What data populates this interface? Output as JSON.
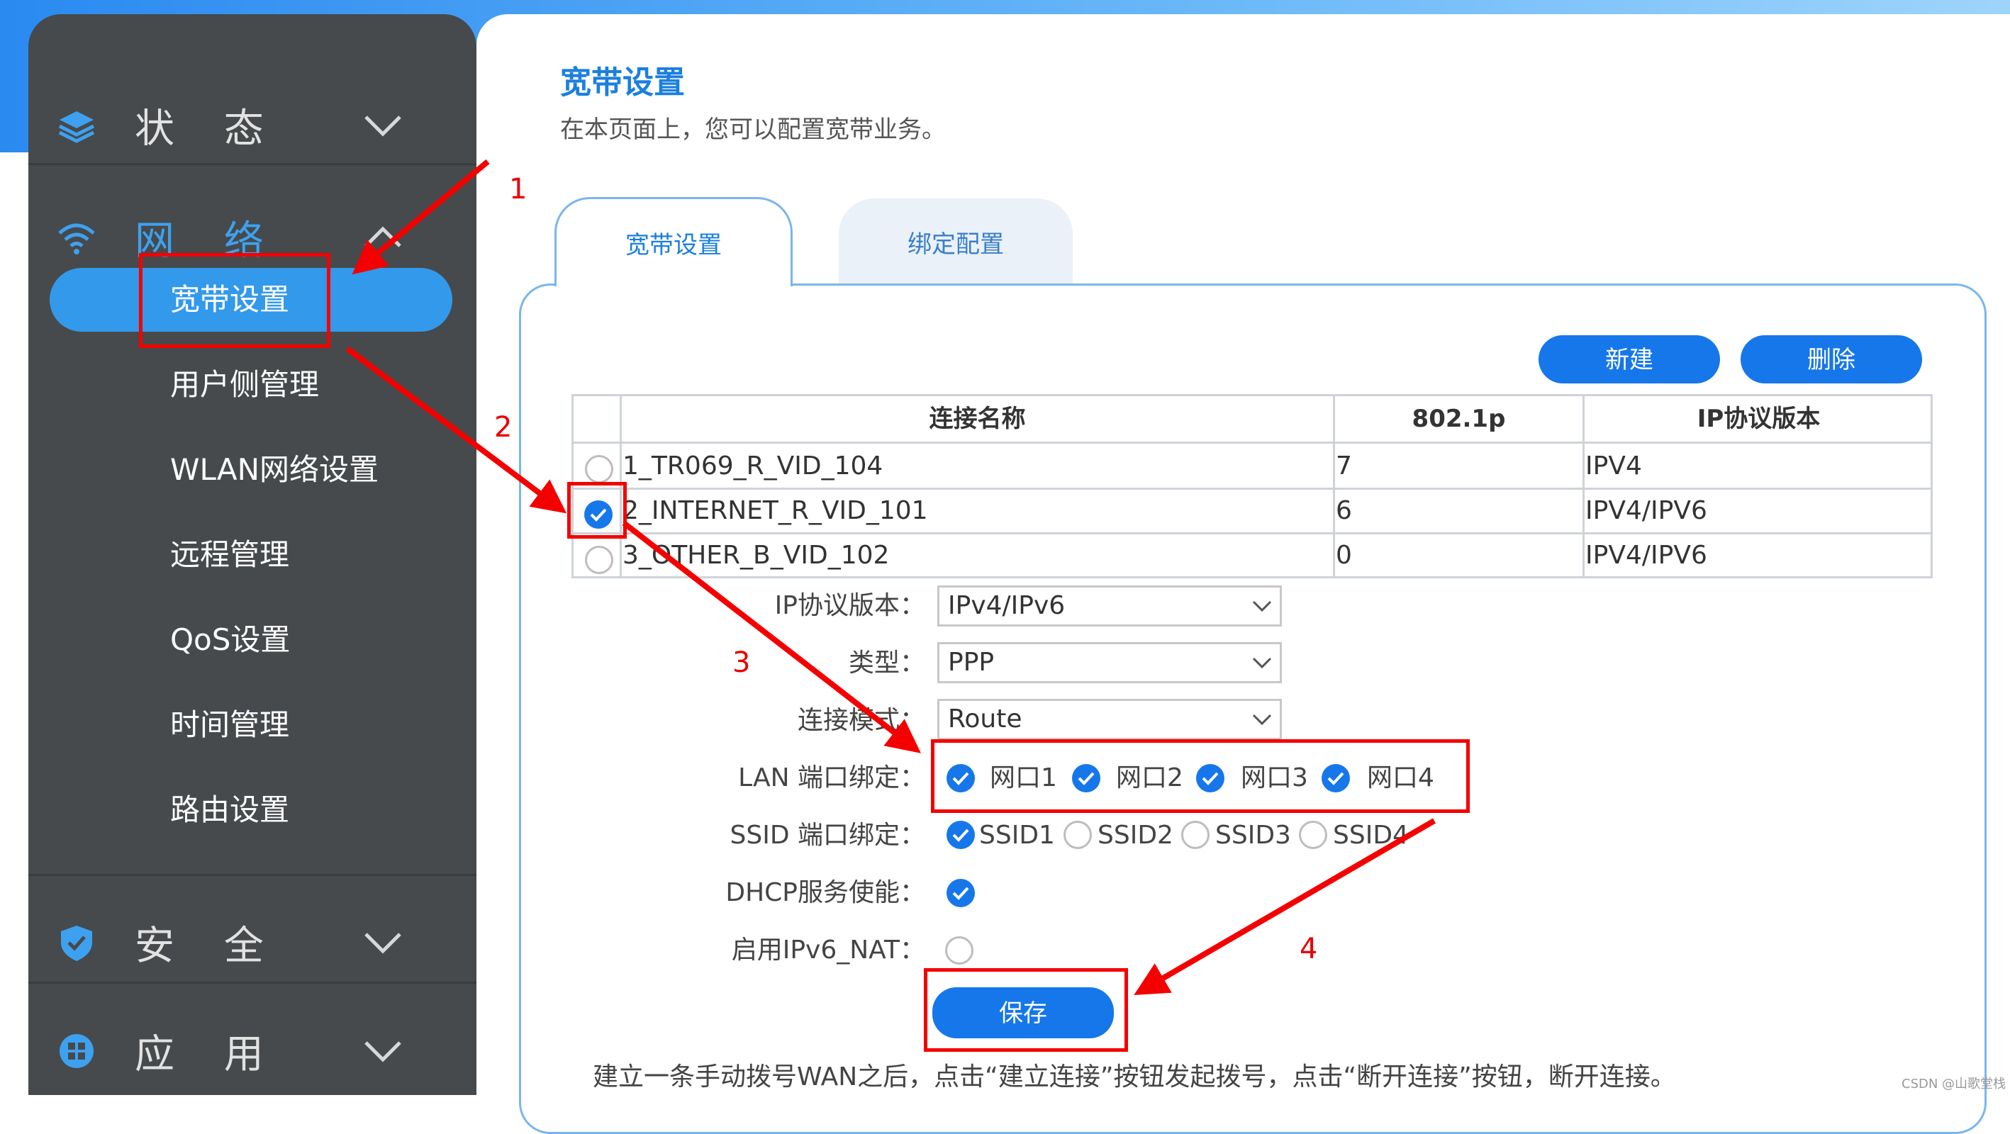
{
  "sidebar": {
    "sections": [
      {
        "label": "状 态",
        "icon": "layers-icon",
        "expanded": false
      },
      {
        "label": "网 络",
        "icon": "wifi-icon",
        "expanded": true
      },
      {
        "label": "安 全",
        "icon": "shield-icon",
        "expanded": false
      },
      {
        "label": "应 用",
        "icon": "apps-icon",
        "expanded": false
      }
    ],
    "network_items": [
      "宽带设置",
      "用户侧管理",
      "WLAN网络设置",
      "远程管理",
      "QoS设置",
      "时间管理",
      "路由设置"
    ],
    "active_item": "宽带设置"
  },
  "header": {
    "title": "宽带设置",
    "description": "在本页面上，您可以配置宽带业务。"
  },
  "tabs": [
    {
      "label": "宽带设置",
      "active": true
    },
    {
      "label": "绑定配置",
      "active": false
    }
  ],
  "toolbar": {
    "new_label": "新建",
    "delete_label": "删除"
  },
  "table": {
    "headers": [
      "连接名称",
      "802.1p",
      "IP协议版本"
    ],
    "rows": [
      {
        "name": "1_TR069_R_VID_104",
        "priority": "7",
        "ip_version": "IPV4",
        "selected": false
      },
      {
        "name": "2_INTERNET_R_VID_101",
        "priority": "6",
        "ip_version": "IPV4/IPV6",
        "selected": true
      },
      {
        "name": "3_OTHER_B_VID_102",
        "priority": "0",
        "ip_version": "IPV4/IPV6",
        "selected": false
      }
    ]
  },
  "form": {
    "ip_version": {
      "label": "IP协议版本：",
      "value": "IPv4/IPv6"
    },
    "type": {
      "label": "类型：",
      "value": "PPP"
    },
    "conn_mode": {
      "label": "连接模式：",
      "value": "Route"
    },
    "lan_binding": {
      "label": "LAN 端口绑定：",
      "options": [
        {
          "label": "网口1",
          "checked": true
        },
        {
          "label": "网口2",
          "checked": true
        },
        {
          "label": "网口3",
          "checked": true
        },
        {
          "label": "网口4",
          "checked": true
        }
      ]
    },
    "ssid_binding": {
      "label": "SSID 端口绑定：",
      "options": [
        {
          "label": "SSID1",
          "checked": true
        },
        {
          "label": "SSID2",
          "checked": false
        },
        {
          "label": "SSID3",
          "checked": false
        },
        {
          "label": "SSID4",
          "checked": false
        }
      ]
    },
    "dhcp": {
      "label": "DHCP服务使能：",
      "checked": true
    },
    "ipv6_nat": {
      "label": "启用IPv6_NAT：",
      "checked": false
    },
    "save_label": "保存"
  },
  "footer_note": "建立一条手动拨号WAN之后，点击“建立连接”按钮发起拨号，点击“断开连接”按钮，断开连接。",
  "annotations": [
    "1",
    "2",
    "3",
    "4"
  ],
  "watermark": "CSDN @山歌堂栈",
  "colors": {
    "accent": "#1677ea",
    "sidebar_bg": "#464a4c",
    "active_item": "#3399ea",
    "annotation": "#f40000",
    "title": "#1b7fe0"
  }
}
